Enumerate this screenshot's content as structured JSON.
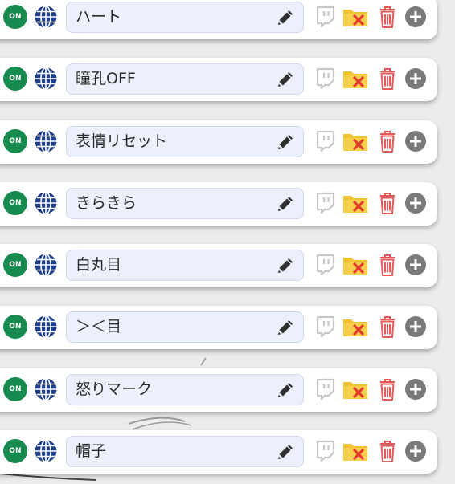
{
  "toggle": {
    "label": "ON",
    "color": "#178a4f"
  },
  "icons": {
    "globe": "globe-icon",
    "edit": "pencil-icon",
    "stream": "twitch-icon",
    "remove_folder": "folder-remove-icon",
    "delete": "trash-icon",
    "add": "plus-circle-icon"
  },
  "colors": {
    "name_field_bg": "#ecf0fb",
    "globe": "#1f3f8c",
    "folder": "#f2c331",
    "folder_x": "#e23a2e",
    "trash": "#e85a5a",
    "plus": "#7a7a7a"
  },
  "items": [
    {
      "name": "ハート"
    },
    {
      "name": "瞳孔OFF"
    },
    {
      "name": "表情リセット"
    },
    {
      "name": "きらきら"
    },
    {
      "name": "白丸目"
    },
    {
      "name": "＞＜目"
    },
    {
      "name": "怒りマーク"
    },
    {
      "name": "帽子"
    }
  ]
}
